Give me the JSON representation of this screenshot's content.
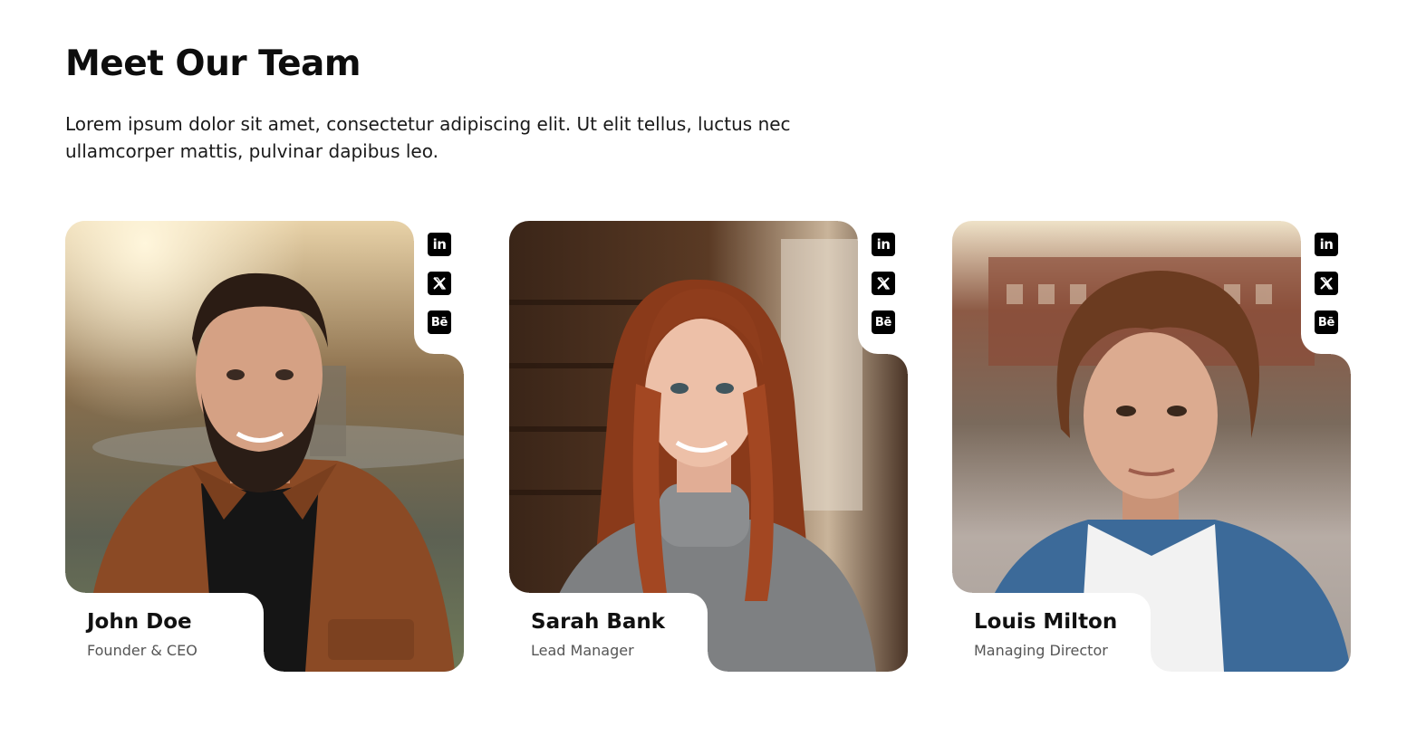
{
  "section": {
    "title": "Meet Our Team",
    "description": "Lorem ipsum dolor sit amet, consectetur adipiscing elit. Ut elit tellus, luctus nec ullamcorper mattis, pulvinar dapibus leo."
  },
  "social_icons": {
    "linkedin": "in",
    "x": "X",
    "behance": "Bē"
  },
  "team": [
    {
      "name": "John Doe",
      "role": "Founder & CEO"
    },
    {
      "name": "Sarah Bank",
      "role": "Lead Manager"
    },
    {
      "name": "Louis Milton",
      "role": "Managing Director"
    }
  ]
}
